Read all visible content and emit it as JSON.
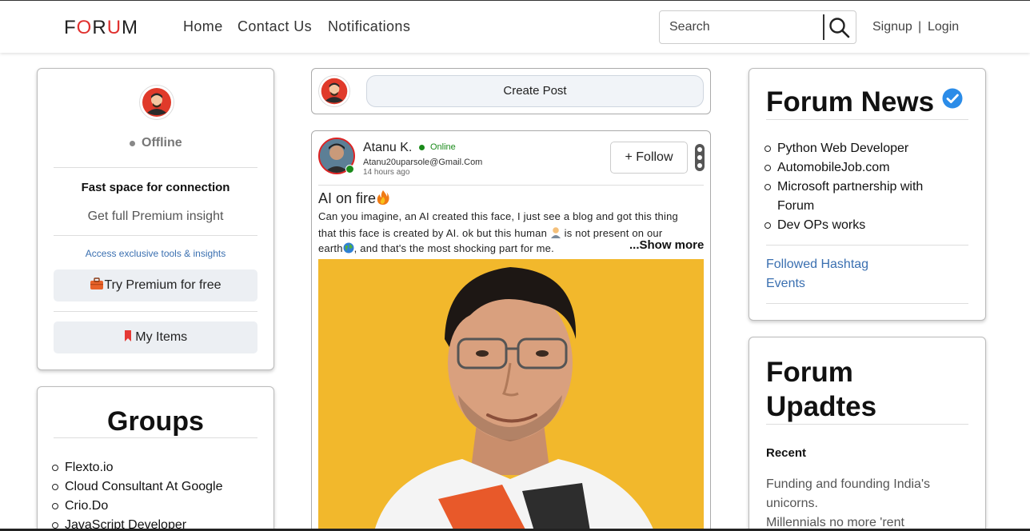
{
  "navbar": {
    "logo_a": "F",
    "logo_b": "O",
    "logo_c": "R",
    "logo_d": "U",
    "logo_e": "M",
    "links": [
      "Home",
      "Contact Us",
      "Notifications"
    ],
    "search_placeholder": "Search",
    "signup": "Signup",
    "separator": "|",
    "login": "Login"
  },
  "profile_card": {
    "status": "Offline",
    "headline": "Fast space for connection",
    "subline": "Get full Premium insight",
    "access_text": "Access exclusive tools & insights",
    "premium_button": "Try Premium for free",
    "items_button": "My Items"
  },
  "groups_card": {
    "title": "Groups",
    "items": [
      "Flexto.io",
      "Cloud Consultant At Google",
      "Crio.Do",
      "JavaScript Developer"
    ]
  },
  "composer": {
    "create_post": "Create Post"
  },
  "post": {
    "author": "Atanu K.",
    "online": "Online",
    "email": "Atanu20uparsole@Gmail.Com",
    "time": "14 hours ago",
    "follow": "+ Follow",
    "title": "AI on fire",
    "body_line1": "Can you imagine, an AI created this face, I just see a blog and got this thing",
    "body_line2a": "that this face is created by AI. ok but this human",
    "body_line2b": "is not present on our",
    "body_line3a": "earth",
    "body_line3b": ", and that's the most shocking part for me.",
    "show_more": "...Show more"
  },
  "news_card": {
    "title": "Forum News",
    "items": [
      "Python Web Developer",
      "AutomobileJob.com",
      "Microsoft partnership with Forum",
      "Dev OPs works"
    ],
    "links": [
      "Followed Hashtag",
      "Events"
    ]
  },
  "updates_card": {
    "title_line1": "Forum",
    "title_line2": "Upadtes",
    "recent_label": "Recent",
    "line1": "Funding and founding India's",
    "line2": "unicorns.",
    "line3": "Millennials no more 'rent"
  },
  "colors": {
    "logo_accent": "#e0312f",
    "online": "#1a8a1a",
    "verified": "#2b8ce8",
    "bookmark": "#e53935",
    "link": "#3a6fb0",
    "photo_bg": "#f2b82c"
  }
}
